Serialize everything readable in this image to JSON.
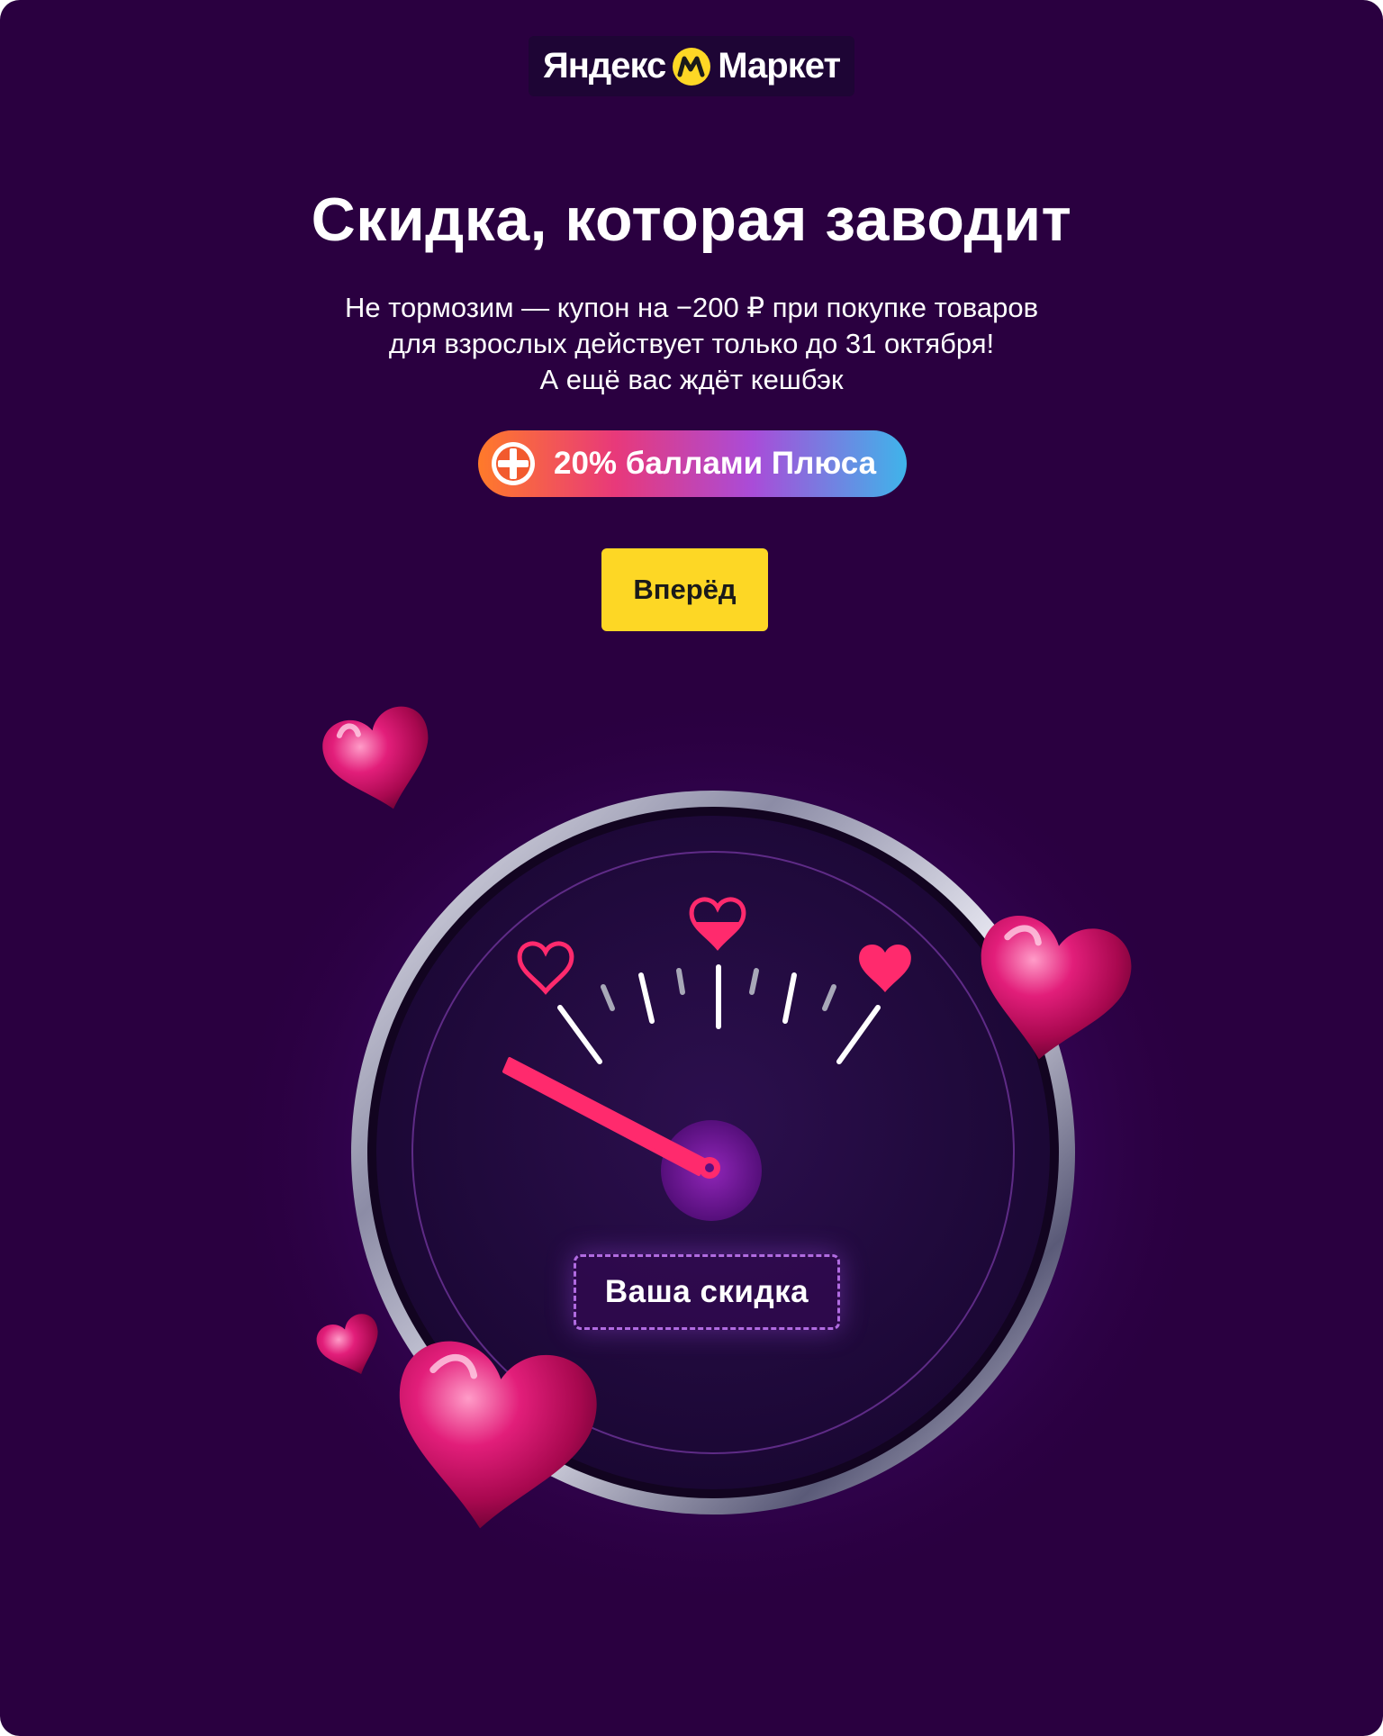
{
  "brand": {
    "left_word": "Яндекс",
    "right_word": "Маркет",
    "logo_icon": "yandex-market-logo-icon",
    "colors": {
      "background": "#2a0040",
      "logo_yellow": "#fdd725"
    }
  },
  "promo": {
    "title": "Скидка, которая заводит",
    "subtitle_lines": [
      "Не тормозим — купон на −200 ₽ при покупке товаров",
      "для взрослых действует только до 31 октября!",
      "А ещё вас ждёт кешбэк"
    ],
    "plus_badge": {
      "icon": "plus-points-icon",
      "text": "20% баллами Плюса"
    },
    "cta_label": "Вперёд"
  },
  "gauge": {
    "label": "Ваша скидка",
    "icons": [
      "heart-outline-icon",
      "heart-half-icon",
      "heart-filled-icon"
    ],
    "accent": "#ff2a6d"
  }
}
